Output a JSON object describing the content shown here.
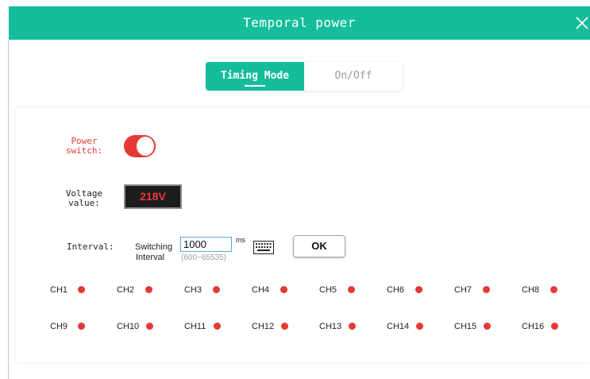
{
  "dialog": {
    "title": "Temporal power",
    "colors": {
      "accent": "#15bd9c",
      "on": "#e53935"
    }
  },
  "mode_tabs": [
    {
      "label": "Timing Mode",
      "active": true
    },
    {
      "label": "On/Off",
      "active": false
    }
  ],
  "power_switch": {
    "label_line1": "Power",
    "label_line2": "switch:",
    "state": "on"
  },
  "voltage": {
    "label_line1": "Voltage",
    "label_line2": "value:",
    "value": "218V"
  },
  "interval": {
    "label": "Interval:",
    "switching_line1": "Switching",
    "switching_line2": "Interval",
    "value": "1000",
    "unit": "ms",
    "range": "(600~65535)",
    "ok_label": "OK"
  },
  "channels": [
    {
      "name": "CH1",
      "status": "on"
    },
    {
      "name": "CH2",
      "status": "on"
    },
    {
      "name": "CH3",
      "status": "on"
    },
    {
      "name": "CH4",
      "status": "on"
    },
    {
      "name": "CH5",
      "status": "on"
    },
    {
      "name": "CH6",
      "status": "on"
    },
    {
      "name": "CH7",
      "status": "on"
    },
    {
      "name": "CH8",
      "status": "on"
    },
    {
      "name": "CH9",
      "status": "on"
    },
    {
      "name": "CH10",
      "status": "on"
    },
    {
      "name": "CH11",
      "status": "on"
    },
    {
      "name": "CH12",
      "status": "on"
    },
    {
      "name": "CH13",
      "status": "on"
    },
    {
      "name": "CH14",
      "status": "on"
    },
    {
      "name": "CH15",
      "status": "on"
    },
    {
      "name": "CH16",
      "status": "on"
    }
  ]
}
